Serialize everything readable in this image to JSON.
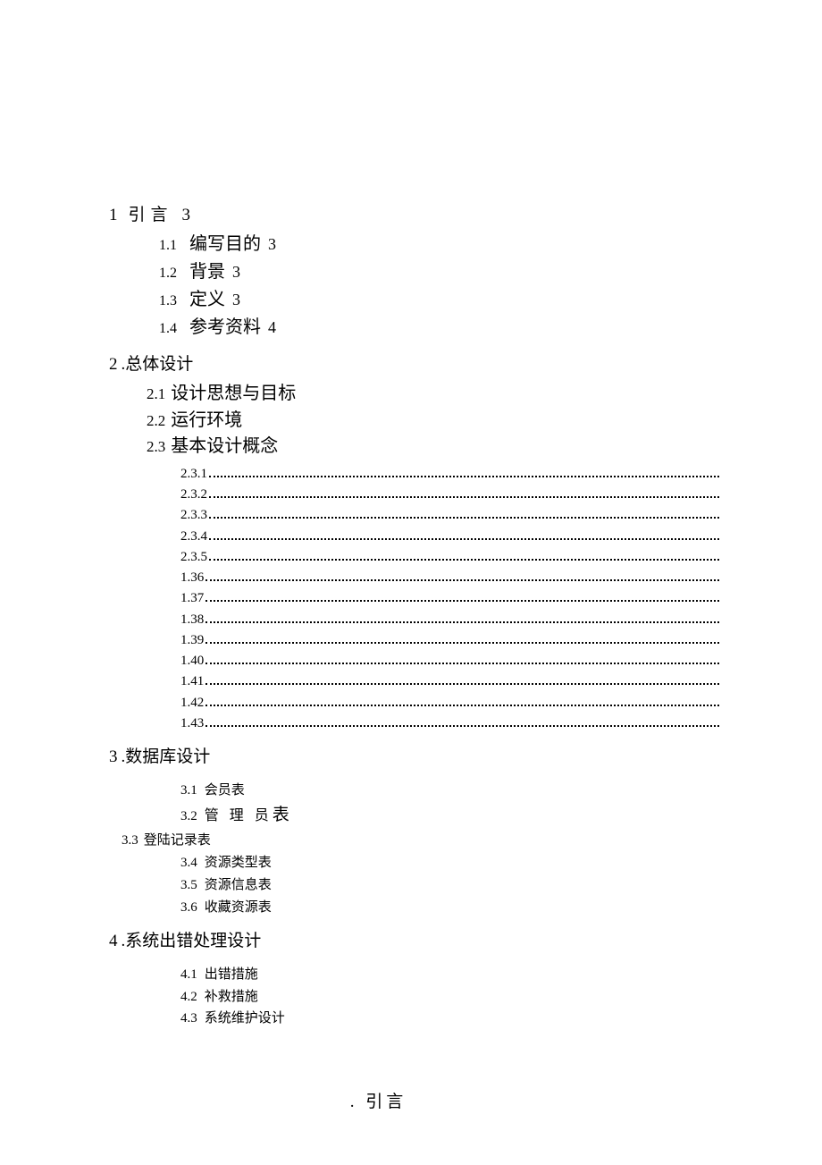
{
  "sec1": {
    "num": "1",
    "title": "引言",
    "page": "3",
    "items": [
      {
        "num": "1.1",
        "title": "编写目的",
        "page": "3"
      },
      {
        "num": "1.2",
        "title": "背景",
        "page": "3"
      },
      {
        "num": "1.3",
        "title": "定义",
        "page": "3"
      },
      {
        "num": "1.4",
        "title": "参考资料",
        "page": "4"
      }
    ]
  },
  "sec2": {
    "num": "2",
    "title": ".总体设计",
    "items": [
      {
        "num": "2.1",
        "title": "设计思想与目标"
      },
      {
        "num": "2.2",
        "title": "运行环境"
      },
      {
        "num": "2.3",
        "title": "基本设计概念"
      }
    ],
    "dotted": [
      "2.3.1",
      "2.3.2",
      "2.3.3",
      "2.3.4",
      "2.3.5",
      "1.36",
      "1.37",
      "1.38",
      "1.39",
      "1.40",
      "1.41",
      "1.42",
      "1.43"
    ]
  },
  "sec3": {
    "num": "3",
    "title": ".数据库设计",
    "items_a": [
      {
        "num": "3.1",
        "title": "会员表"
      },
      {
        "num": "3.2",
        "title": "管 理 员"
      }
    ],
    "biao": "表",
    "item33": {
      "num": "3.3",
      "title": "登陆记录表"
    },
    "items_b": [
      {
        "num": "3.4",
        "title": "资源类型表"
      },
      {
        "num": "3.5",
        "title": "资源信息表"
      },
      {
        "num": "3.6",
        "title": "收藏资源表"
      }
    ]
  },
  "sec4": {
    "num": "4",
    "title": ".系统出错处理设计",
    "items": [
      {
        "num": "4.1",
        "title": "出错措施"
      },
      {
        "num": "4.2",
        "title": "补救措施"
      },
      {
        "num": "4.3",
        "title": "系统维护设计"
      }
    ]
  },
  "footer": ". 引言"
}
